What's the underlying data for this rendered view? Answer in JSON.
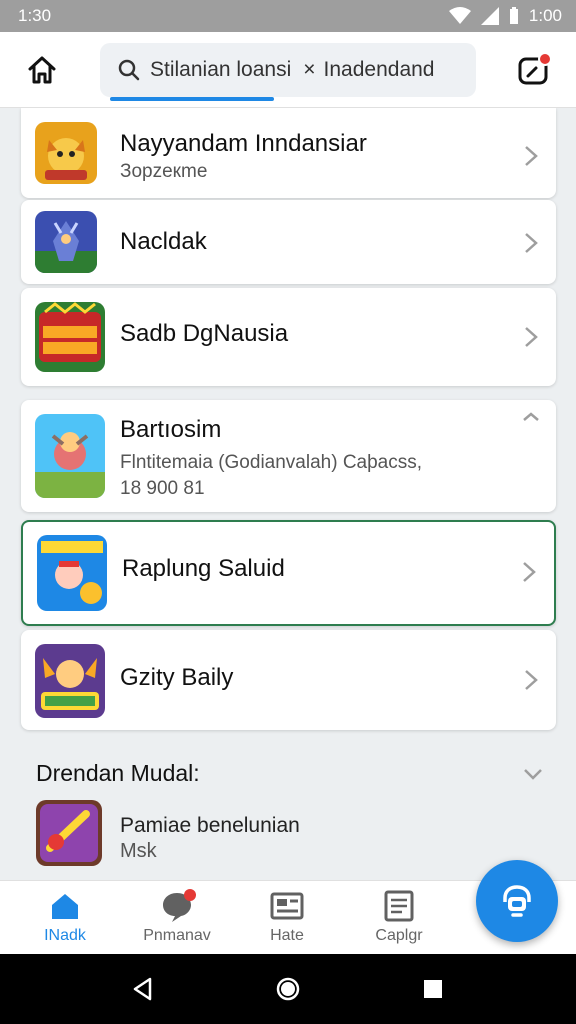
{
  "status_bar": {
    "time": "1:30",
    "right_time": "1:00"
  },
  "app_bar": {
    "search_text": "Stilanian loansi",
    "search_clear": "×",
    "search_extra": "Inadendand"
  },
  "items": [
    {
      "title": "Nayyandam Inndansiar",
      "subtitle": "Зорzекme"
    },
    {
      "title": "Nacldak",
      "subtitle": ""
    },
    {
      "title": "Sadb DgNausia",
      "subtitle": ""
    },
    {
      "title": "Bartıosim",
      "subtitle": "Flntitemaia (Godianvalah) Caþacss,",
      "subtitle2": "18 900 81"
    },
    {
      "title": "Raplung Saluid",
      "subtitle": ""
    },
    {
      "title": "Gzity Baily",
      "subtitle": ""
    }
  ],
  "section": {
    "title": "Drendan Mudal:",
    "item_title": "Pamiae benelunian",
    "item_sub": "Msk"
  },
  "bottom_nav": [
    {
      "label": "INadk"
    },
    {
      "label": "Pnmanav"
    },
    {
      "label": "Hate"
    },
    {
      "label": "Caplgr"
    }
  ],
  "colors": {
    "accent": "#1e88e5",
    "selected_border": "#2e7d4f",
    "badge": "#e53935"
  }
}
